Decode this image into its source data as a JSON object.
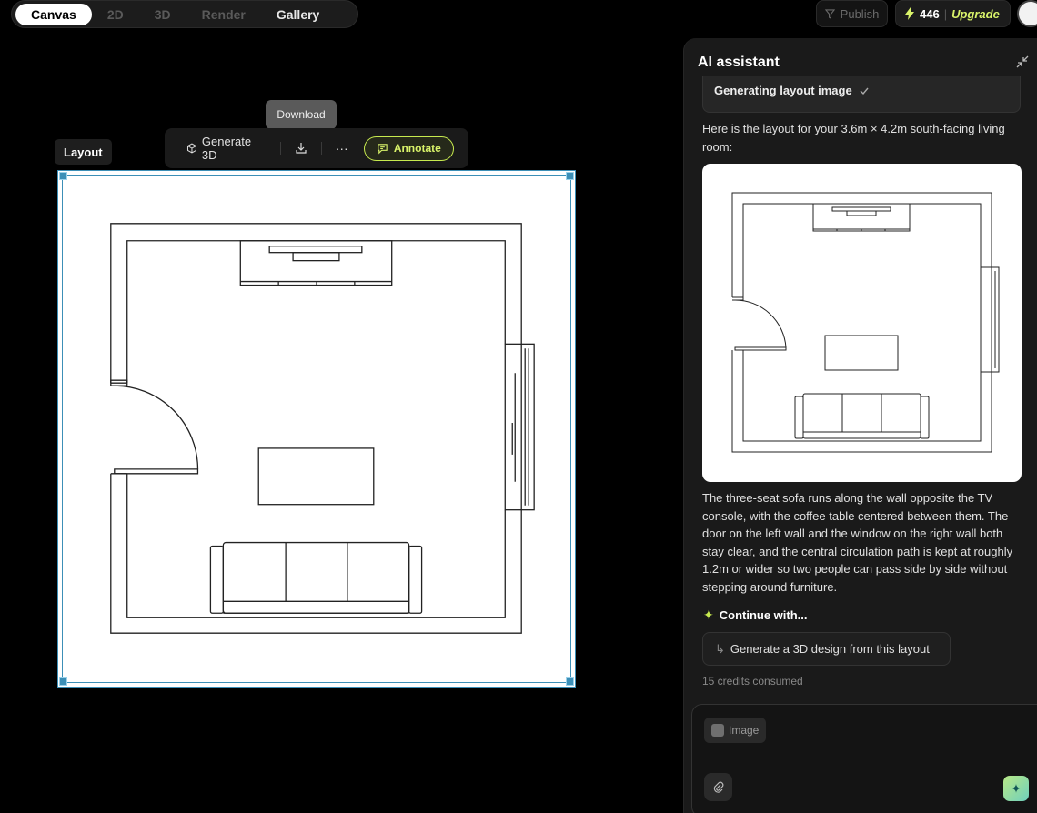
{
  "modes": {
    "tabs": [
      {
        "label": "Canvas"
      },
      {
        "label": "2D"
      },
      {
        "label": "3D"
      },
      {
        "label": "Render"
      },
      {
        "label": "Gallery"
      }
    ],
    "active": "Canvas"
  },
  "topbar": {
    "publish_label": "Publish",
    "credits": "446",
    "upgrade_label": "Upgrade"
  },
  "canvas": {
    "layout_label": "Layout",
    "tooltip": "Download",
    "toolbar": {
      "generate_label": "Generate 3D",
      "more_label": "···",
      "annotate_label": "Annotate"
    },
    "accent_color": "#3c8fb7"
  },
  "assistant": {
    "title": "AI assistant",
    "status": "Generating layout image",
    "intro": "Here is the layout for your 3.6m × 4.2m south-facing living room:",
    "body": "The three-seat sofa runs along the wall opposite the TV console, with the coffee table centered between them. The door on the left wall and the window on the right wall both stay clear, and the central circulation path is kept at roughly 1.2m or wider so two people can pass side by side without stepping around furniture.",
    "continue_label": "Continue with...",
    "suggestion": "Generate a 3D design from this layout",
    "consumed": "15 credits consumed",
    "input": {
      "image_chip": "Image"
    },
    "accent_color": "#c7ea4f"
  }
}
